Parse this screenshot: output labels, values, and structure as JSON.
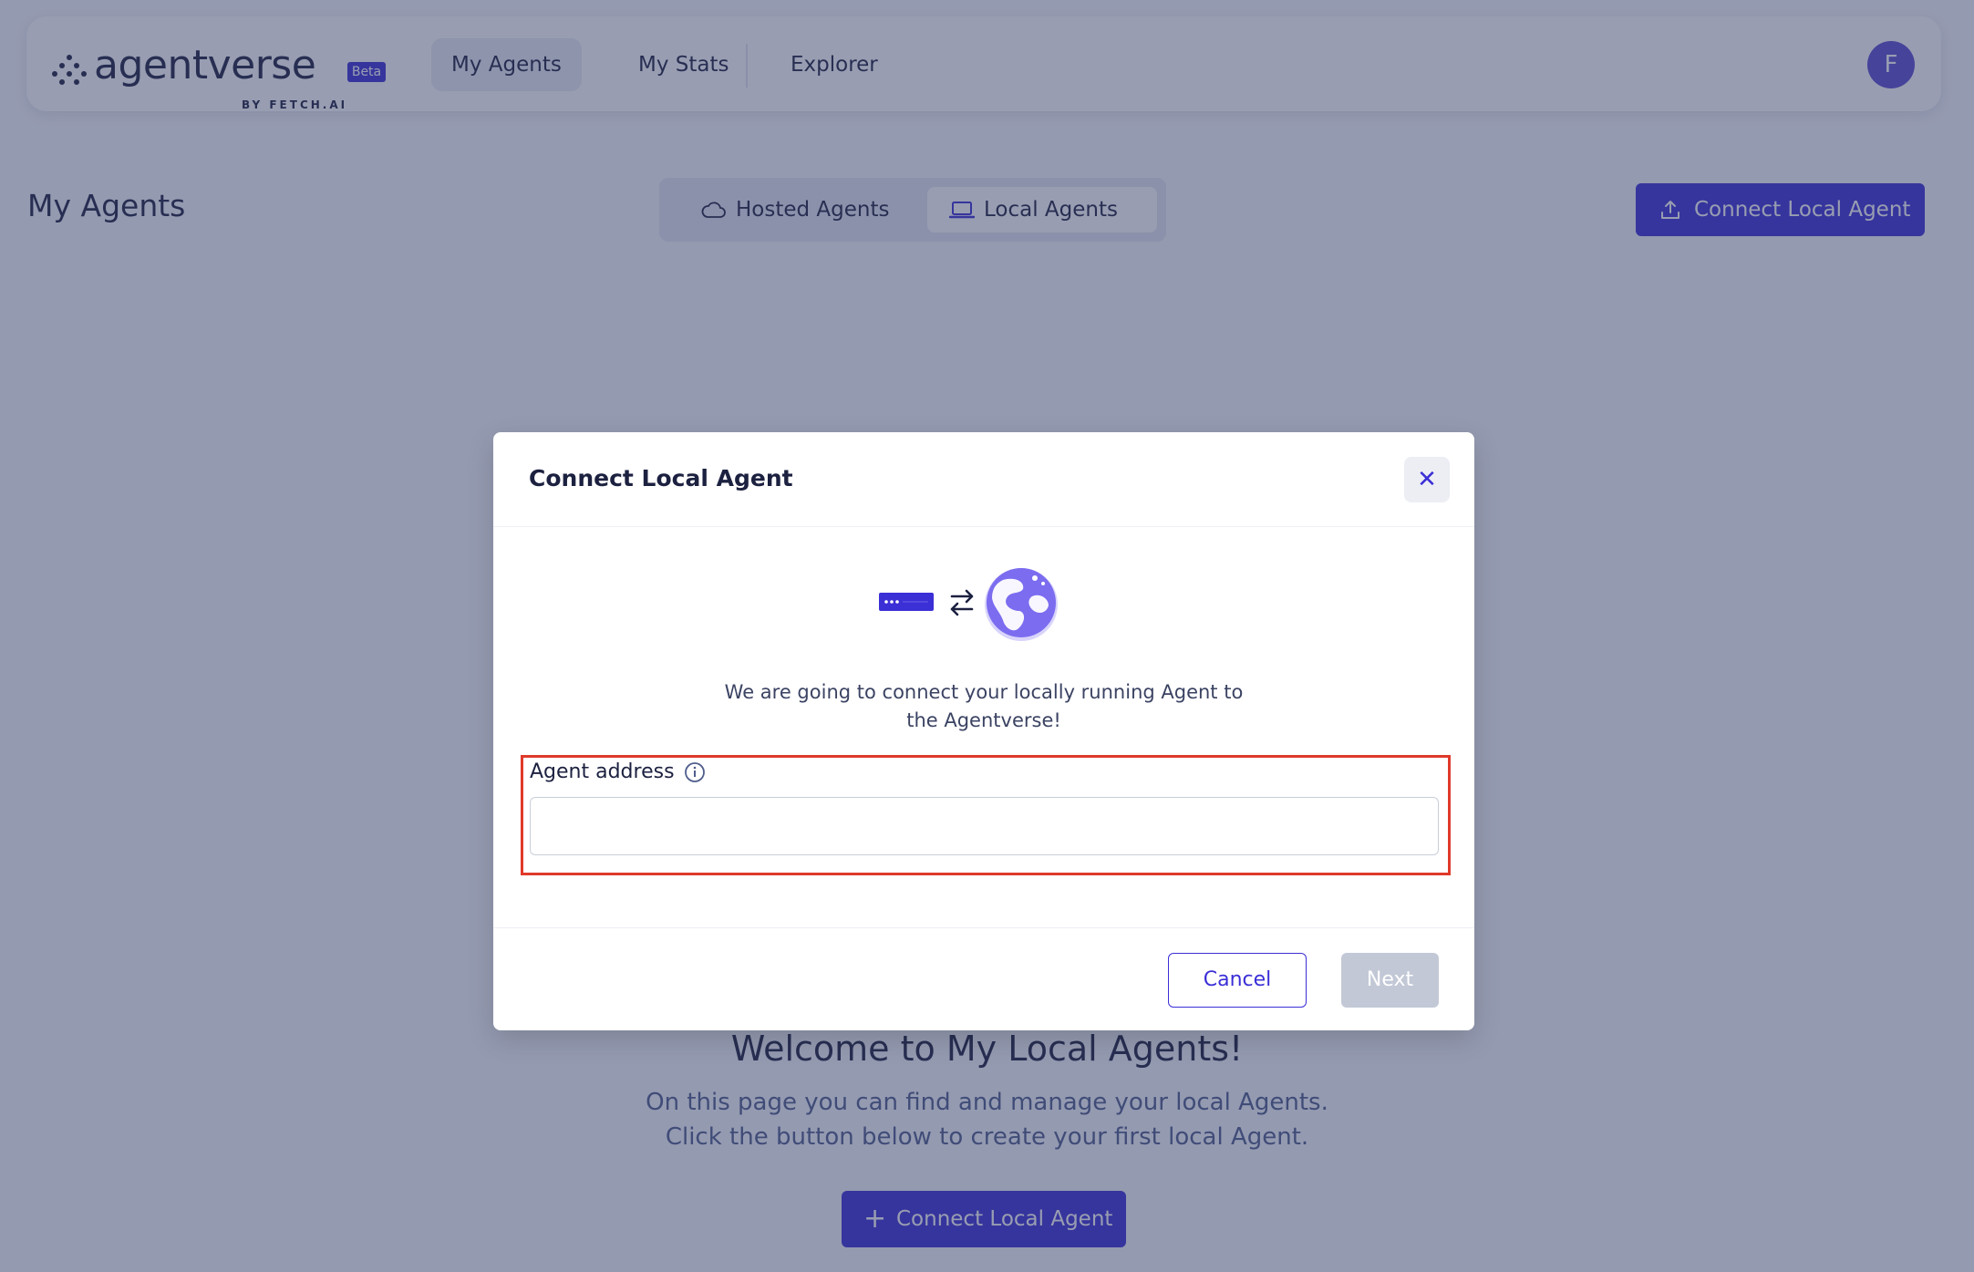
{
  "app": {
    "logo_text": "agentverse",
    "logo_badge": "Beta",
    "logo_subtitle": "BY FETCH.AI"
  },
  "nav": {
    "items": [
      {
        "label": "My Agents",
        "active": true
      },
      {
        "label": "My Stats",
        "active": false
      },
      {
        "label": "Explorer",
        "active": false
      }
    ],
    "avatar_initial": "F"
  },
  "page": {
    "title": "My Agents",
    "tabs": [
      {
        "label": "Hosted Agents",
        "icon": "cloud-icon",
        "active": false
      },
      {
        "label": "Local Agents",
        "icon": "laptop-icon",
        "active": true
      }
    ],
    "connect_button_label": "Connect Local Agent"
  },
  "empty_state": {
    "title": "Welcome to My Local Agents!",
    "line1": "On this page you can find and manage your local Agents.",
    "line2": "Click the button below to create your first local Agent.",
    "button_label": "Connect Local Agent"
  },
  "modal": {
    "title": "Connect Local Agent",
    "close_glyph": "✕",
    "description_line1": "We are going to connect your locally running Agent to",
    "description_line2": "the Agentverse!",
    "field_label": "Agent address",
    "field_value": "",
    "field_placeholder": "",
    "cancel_label": "Cancel",
    "next_label": "Next",
    "next_enabled": false
  },
  "colors": {
    "accent": "#3b2fd6",
    "highlight_frame": "#e0392b",
    "avatar": "#5b4bd0",
    "disabled_button": "#c2c8d6"
  }
}
